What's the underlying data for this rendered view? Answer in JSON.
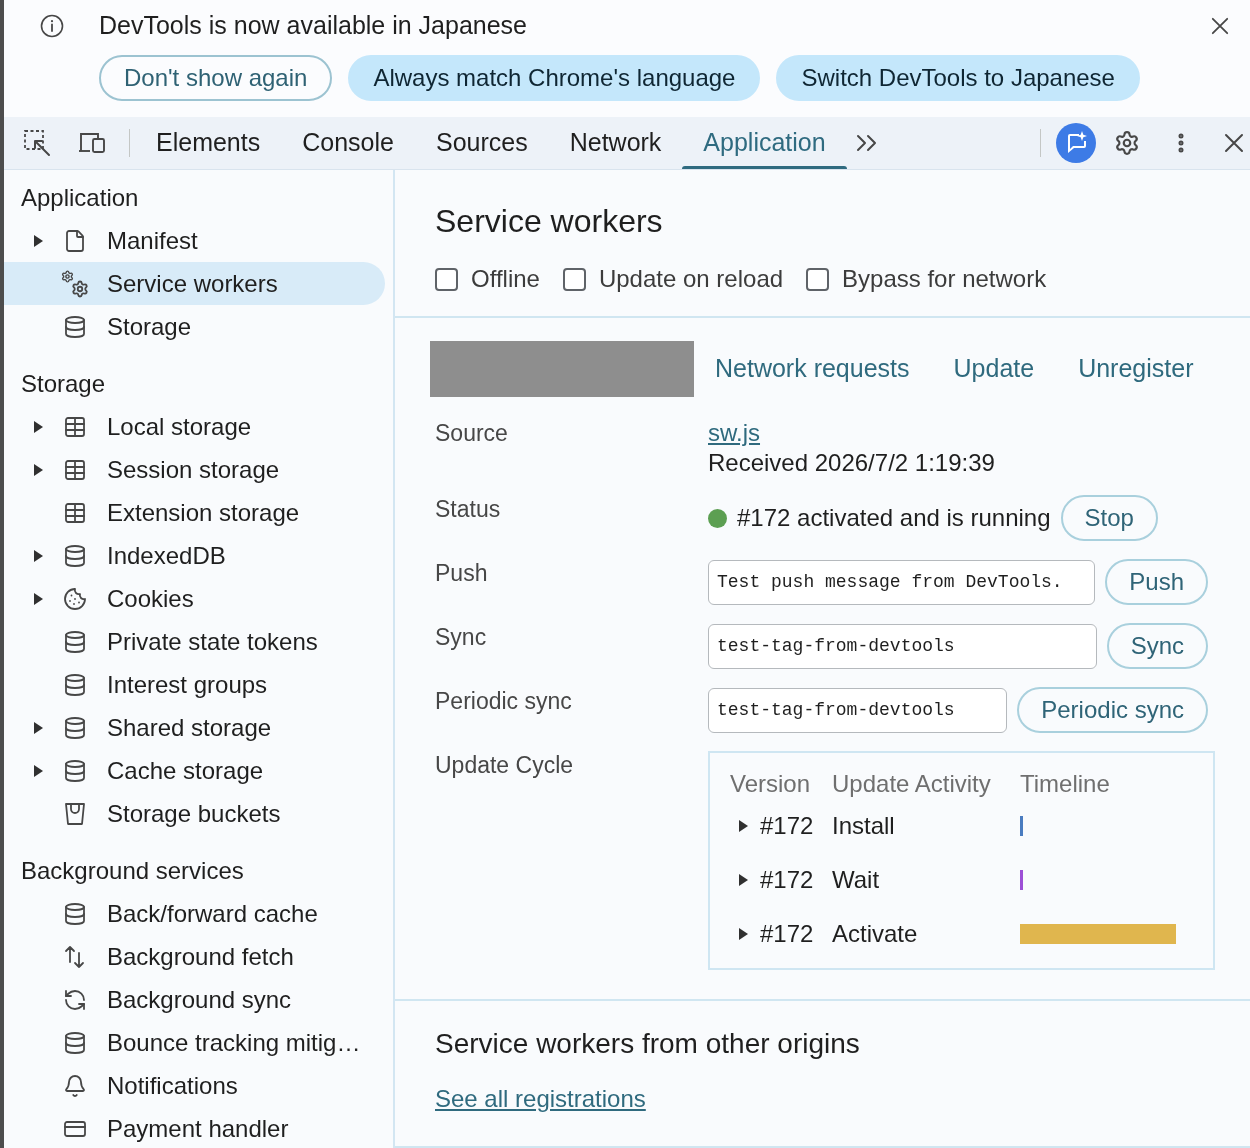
{
  "infobar": {
    "message": "DevTools is now available in Japanese",
    "buttons": [
      {
        "label": "Don't show again",
        "kind": "outlined"
      },
      {
        "label": "Always match Chrome's language",
        "kind": "filled"
      },
      {
        "label": "Switch DevTools to Japanese",
        "kind": "filled"
      }
    ]
  },
  "toolbar": {
    "tabs": [
      {
        "label": "Elements",
        "selected": false
      },
      {
        "label": "Console",
        "selected": false
      },
      {
        "label": "Sources",
        "selected": false
      },
      {
        "label": "Network",
        "selected": false
      },
      {
        "label": "Application",
        "selected": true
      }
    ]
  },
  "sidebar": {
    "sections": [
      {
        "title": "Application",
        "items": [
          {
            "label": "Manifest",
            "kind": "file",
            "expandable": true,
            "selected": false
          },
          {
            "label": "Service workers",
            "kind": "worker",
            "expandable": false,
            "selected": true
          },
          {
            "label": "Storage",
            "kind": "store",
            "expandable": false,
            "selected": false
          }
        ]
      },
      {
        "title": "Storage",
        "items": [
          {
            "label": "Local storage",
            "kind": "table",
            "expandable": true,
            "selected": false
          },
          {
            "label": "Session storage",
            "kind": "table",
            "expandable": true,
            "selected": false
          },
          {
            "label": "Extension storage",
            "kind": "table",
            "expandable": false,
            "selected": false
          },
          {
            "label": "IndexedDB",
            "kind": "store",
            "expandable": true,
            "selected": false
          },
          {
            "label": "Cookies",
            "kind": "cookies",
            "expandable": true,
            "selected": false
          },
          {
            "label": "Private state tokens",
            "kind": "store",
            "expandable": false,
            "selected": false
          },
          {
            "label": "Interest groups",
            "kind": "store",
            "expandable": false,
            "selected": false
          },
          {
            "label": "Shared storage",
            "kind": "store",
            "expandable": true,
            "selected": false
          },
          {
            "label": "Cache storage",
            "kind": "store",
            "expandable": true,
            "selected": false
          },
          {
            "label": "Storage buckets",
            "kind": "bucket",
            "expandable": false,
            "selected": false
          }
        ]
      },
      {
        "title": "Background services",
        "items": [
          {
            "label": "Back/forward cache",
            "kind": "store",
            "expandable": false,
            "selected": false
          },
          {
            "label": "Background fetch",
            "kind": "fetch",
            "expandable": false,
            "selected": false
          },
          {
            "label": "Background sync",
            "kind": "sync",
            "expandable": false,
            "selected": false
          },
          {
            "label": "Bounce tracking mitig…",
            "kind": "store",
            "expandable": false,
            "selected": false
          },
          {
            "label": "Notifications",
            "kind": "notifications",
            "expandable": false,
            "selected": false
          },
          {
            "label": "Payment handler",
            "kind": "payment",
            "expandable": false,
            "selected": false
          }
        ]
      }
    ]
  },
  "main": {
    "title": "Service workers",
    "options": [
      {
        "label": "Offline",
        "checked": false
      },
      {
        "label": "Update on reload",
        "checked": false
      },
      {
        "label": "Bypass for network",
        "checked": false
      }
    ],
    "registration": {
      "actions": [
        "Network requests",
        "Update",
        "Unregister"
      ],
      "source": {
        "label": "Source",
        "file": "sw.js",
        "received": "Received 2026/7/2 1:19:39"
      },
      "status": {
        "label": "Status",
        "running": true,
        "text": "#172 activated and is running",
        "button": "Stop"
      },
      "triggers": [
        {
          "label": "Push",
          "value": "Test push message from DevTools.",
          "button": "Push"
        },
        {
          "label": "Sync",
          "value": "test-tag-from-devtools",
          "button": "Sync"
        },
        {
          "label": "Periodic sync",
          "value": "test-tag-from-devtools",
          "button": "Periodic sync"
        }
      ],
      "update_cycle": {
        "label": "Update Cycle",
        "columns": [
          "Version",
          "Update Activity",
          "Timeline"
        ],
        "rows": [
          {
            "version": "#172",
            "activity": "Install",
            "expanded": false,
            "timeline": {
              "kind": "mark",
              "color": "#4a7cc0"
            }
          },
          {
            "version": "#172",
            "activity": "Wait",
            "expanded": false,
            "timeline": {
              "kind": "mark",
              "color": "#9d4fd6"
            }
          },
          {
            "version": "#172",
            "activity": "Activate",
            "expanded": false,
            "timeline": {
              "kind": "bar",
              "color": "#e0b64e"
            }
          }
        ]
      }
    },
    "other_origins": {
      "title": "Service workers from other origins",
      "link": "See all registrations"
    }
  }
}
